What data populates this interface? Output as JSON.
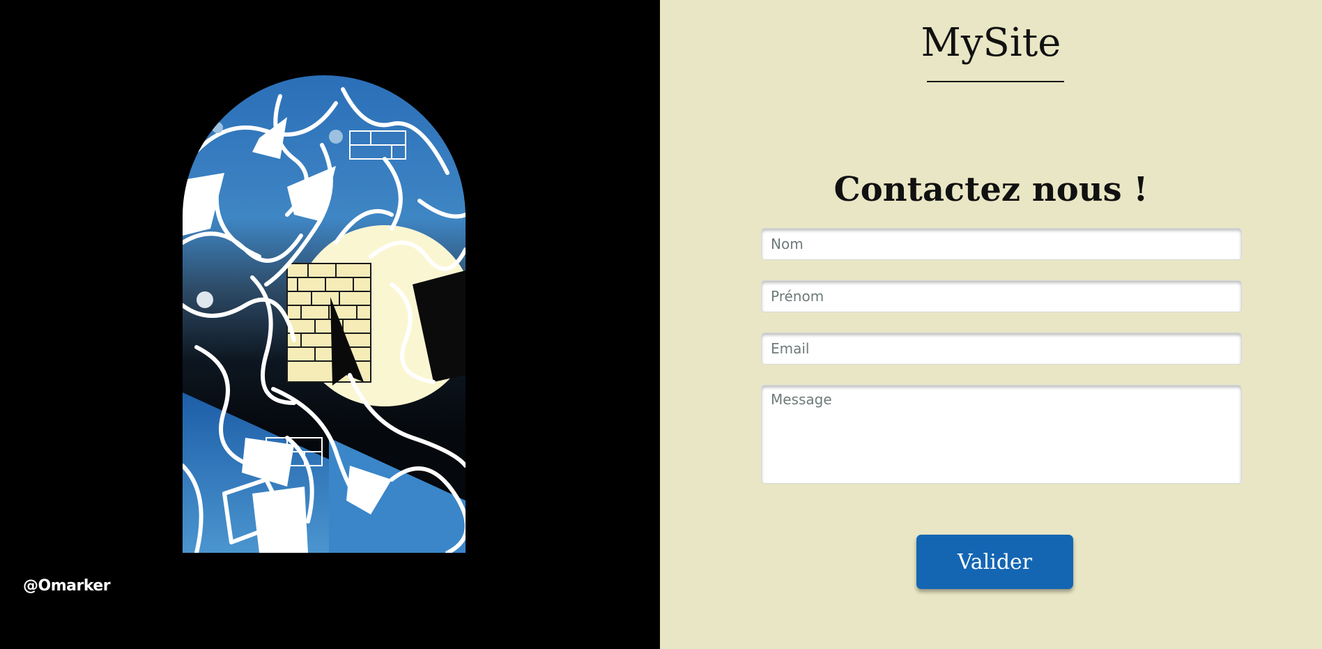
{
  "credit": {
    "handle": "@Omarker"
  },
  "header": {
    "site_title": "MySite"
  },
  "contact": {
    "heading": "Contactez nous !",
    "fields": {
      "nom_placeholder": "Nom",
      "prenom_placeholder": "Prénom",
      "email_placeholder": "Email",
      "message_placeholder": "Message"
    },
    "submit_label": "Valider"
  },
  "colors": {
    "left_background": "#000000",
    "right_background": "#e8e6c4",
    "button": "#1466b3",
    "text": "#111111"
  },
  "artwork": {
    "subject": "stained-glass arched window with night sky, moon and brick wall"
  }
}
